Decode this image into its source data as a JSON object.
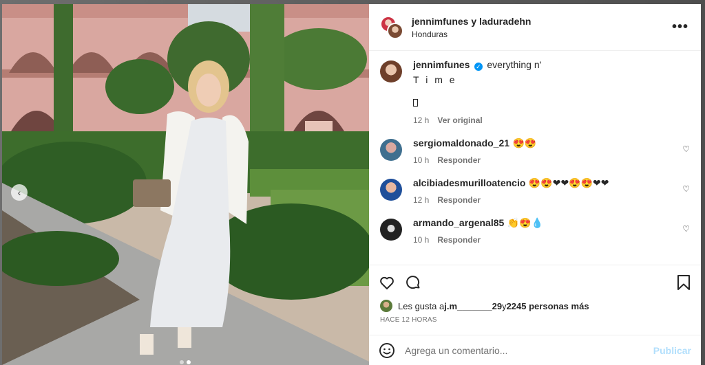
{
  "post": {
    "carousel": {
      "dots_count": 2,
      "active_index": 1
    }
  },
  "header": {
    "names": "jennimfunes y laduradehn",
    "location": "Honduras",
    "more_label": "•••"
  },
  "caption": {
    "username": "jennimfunes",
    "verified_mark": "✓",
    "text": "everything n'",
    "line2": "T i m e",
    "time": "12 h",
    "see_original": "Ver original"
  },
  "comments": [
    {
      "username": "sergiomaldonado_21",
      "text": "😍😍",
      "time": "10 h",
      "reply": "Responder"
    },
    {
      "username": "alcibiadesmurilloatencio",
      "text": "😍😍❤❤😍😍❤❤",
      "time": "12 h",
      "reply": "Responder"
    },
    {
      "username": "armando_argenal85",
      "text": "👏😍💧",
      "time": "10 h",
      "reply": "Responder"
    }
  ],
  "likes": {
    "prefix": "Les gusta a ",
    "user": "j.m_______29",
    "middle": " y ",
    "others": "2245 personas más"
  },
  "time_ago": "HACE 12 HORAS",
  "add_comment": {
    "placeholder": "Agrega un comentario...",
    "publish_label": "Publicar"
  },
  "icons": {
    "heart": "heart-icon",
    "comment": "comment-icon",
    "save": "bookmark-icon",
    "emoji": "smiley-icon",
    "prev": "chevron-left-icon",
    "more": "more-options-icon"
  }
}
